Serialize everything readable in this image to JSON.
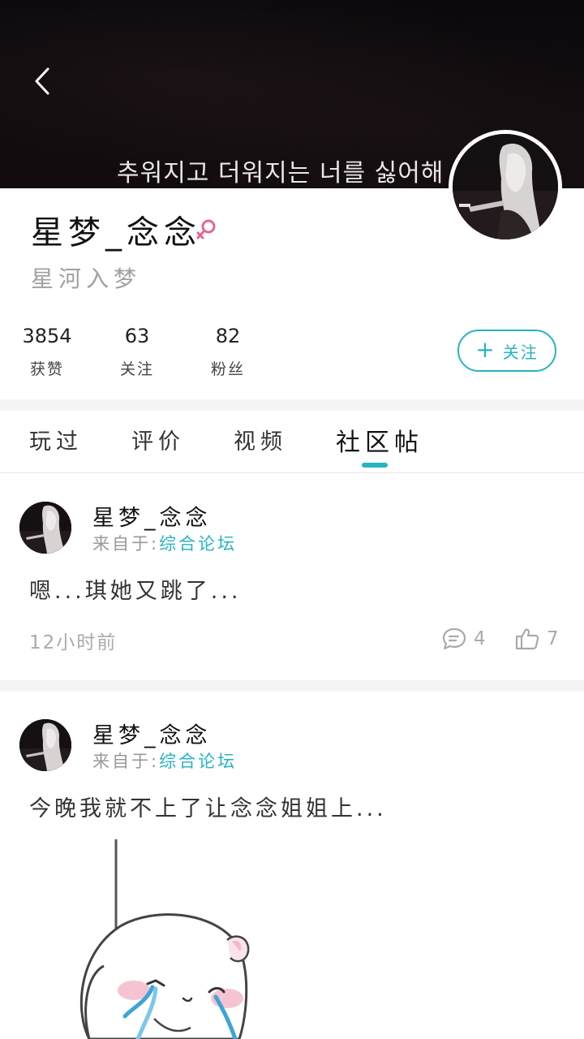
{
  "header": {
    "caption": "추워지고 더워지는 너를 싫어해"
  },
  "icons": {
    "back": "back-arrow-icon",
    "gender": "female-icon",
    "comment": "comment-icon",
    "like": "thumbs-up-icon"
  },
  "profile": {
    "name": "星梦_念念",
    "signature": "星河入梦",
    "stats": [
      {
        "value": "3854",
        "label": "获赞"
      },
      {
        "value": "63",
        "label": "关注"
      },
      {
        "value": "82",
        "label": "粉丝"
      }
    ],
    "follow_label": "关注"
  },
  "tabs": [
    "玩过",
    "评价",
    "视频",
    "社区帖"
  ],
  "active_tab": "社区帖",
  "colors": {
    "accent": "#27b4c0",
    "gender": "#e3659a"
  },
  "posts": [
    {
      "author": "星梦_念念",
      "source_prefix": "来自于:",
      "forum": "综合论坛",
      "text": "嗯...琪她又跳了...",
      "time": "12小时前",
      "comments": "4",
      "likes": "7"
    },
    {
      "author": "星梦_念念",
      "source_prefix": "来自于:",
      "forum": "综合论坛",
      "text": "今晚我就不上了让念念姐姐上..."
    }
  ]
}
